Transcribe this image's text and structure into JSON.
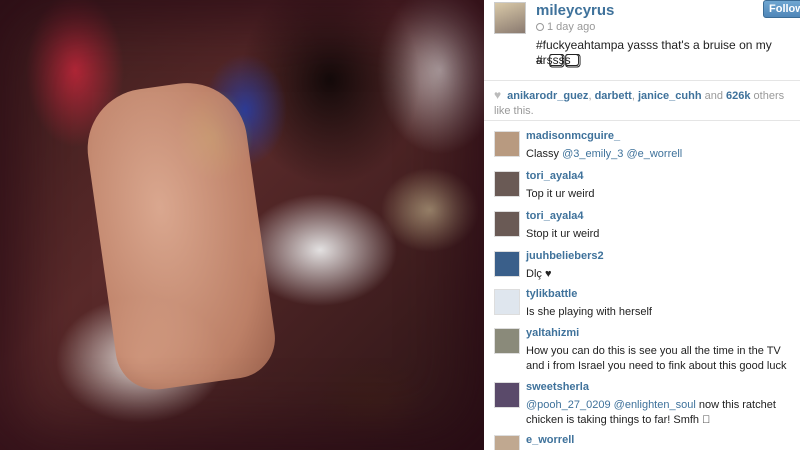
{
  "post": {
    "username": "mileycyrus",
    "time": "1 day ago",
    "follow_label": "Follow",
    "caption": "#fuckyeahtampa yasss that's a bruise on my arssss",
    "caption_glyphs": [
      "#",
      "⃣⃣",
      "⃣⃣"
    ]
  },
  "likes": {
    "user1": "anikarodr_guez",
    "sep1": ", ",
    "user2": "darbett",
    "sep2": ", ",
    "user3": "janice_cuhh",
    "and": " and ",
    "count": "626k",
    "suffix": " others like this."
  },
  "comments": [
    {
      "user": "madisonmcguire_",
      "pre": "Classy ",
      "m1": "@3_emily_3",
      "mid": " ",
      "m2": "@e_worrell",
      "post": "",
      "avatar_color": "#b89a80"
    },
    {
      "user": "tori_ayala4",
      "pre": "Top it ur weird",
      "m1": "",
      "mid": "",
      "m2": "",
      "post": "",
      "avatar_color": "#6a5a55"
    },
    {
      "user": "tori_ayala4",
      "pre": "Stop it ur weird",
      "m1": "",
      "mid": "",
      "m2": "",
      "post": "",
      "avatar_color": "#6a5a55"
    },
    {
      "user": "juuhbeliebers2",
      "pre": "Dlç ♥",
      "m1": "",
      "mid": "",
      "m2": "",
      "post": "",
      "avatar_color": "#3a5f8a"
    },
    {
      "user": "tylikbattle",
      "pre": "Is she playing with herself",
      "m1": "",
      "mid": "",
      "m2": "",
      "post": "",
      "avatar_color": "#dfe6ee"
    },
    {
      "user": "yaltahizmi",
      "pre": "How you can do this is see you all the time in the TV and i from Israel you need to fink about this good luck",
      "m1": "",
      "mid": "",
      "m2": "",
      "post": "",
      "avatar_color": "#8a8a7a"
    },
    {
      "user": "sweetsherla",
      "pre": "",
      "m1": "@pooh_27_0209",
      "mid": " ",
      "m2": "@enlighten_soul",
      "post": " now this ratchet chicken is taking things to far! Smfh ⃣",
      "avatar_color": "#5a4a6a"
    },
    {
      "user": "e_worrell",
      "pre": "",
      "m1": "",
      "mid": "",
      "m2": "",
      "post": "",
      "avatar_color": "#c0a890"
    }
  ],
  "colors": {
    "link": "#3f729b",
    "follow_button": "#4f86b8"
  },
  "icons": [
    "heart-icon",
    "clock-icon"
  ]
}
